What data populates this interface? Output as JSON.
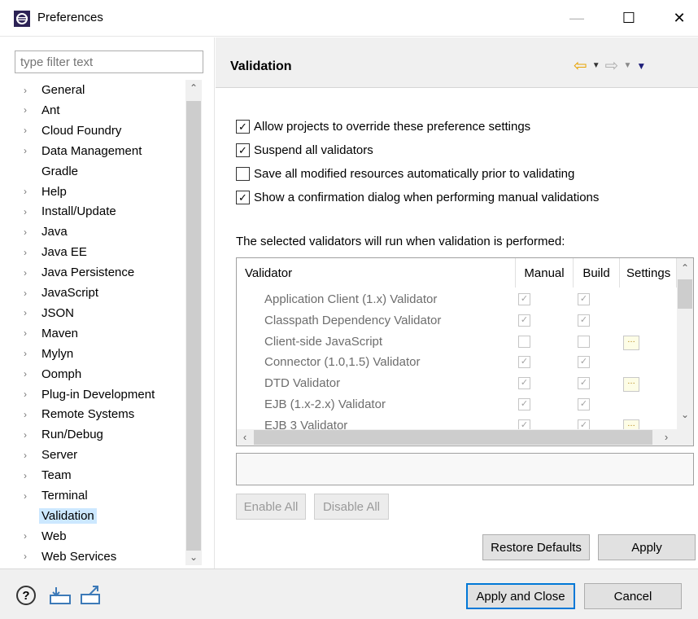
{
  "window": {
    "title": "Preferences",
    "minimize": "—",
    "maximize": "☐",
    "close": "✕"
  },
  "filter": {
    "placeholder": "type filter text"
  },
  "tree": {
    "items": [
      {
        "label": "General",
        "expandable": true
      },
      {
        "label": "Ant",
        "expandable": true
      },
      {
        "label": "Cloud Foundry",
        "expandable": true
      },
      {
        "label": "Data Management",
        "expandable": true
      },
      {
        "label": "Gradle",
        "expandable": false
      },
      {
        "label": "Help",
        "expandable": true
      },
      {
        "label": "Install/Update",
        "expandable": true
      },
      {
        "label": "Java",
        "expandable": true
      },
      {
        "label": "Java EE",
        "expandable": true
      },
      {
        "label": "Java Persistence",
        "expandable": true
      },
      {
        "label": "JavaScript",
        "expandable": true
      },
      {
        "label": "JSON",
        "expandable": true
      },
      {
        "label": "Maven",
        "expandable": true
      },
      {
        "label": "Mylyn",
        "expandable": true
      },
      {
        "label": "Oomph",
        "expandable": true
      },
      {
        "label": "Plug-in Development",
        "expandable": true
      },
      {
        "label": "Remote Systems",
        "expandable": true
      },
      {
        "label": "Run/Debug",
        "expandable": true
      },
      {
        "label": "Server",
        "expandable": true
      },
      {
        "label": "Team",
        "expandable": true
      },
      {
        "label": "Terminal",
        "expandable": true
      },
      {
        "label": "Validation",
        "expandable": false,
        "selected": true
      },
      {
        "label": "Web",
        "expandable": true
      },
      {
        "label": "Web Services",
        "expandable": true
      }
    ]
  },
  "page": {
    "title": "Validation",
    "options": [
      {
        "label": "Allow projects to override these preference settings",
        "checked": true
      },
      {
        "label": "Suspend all validators",
        "checked": true
      },
      {
        "label": "Save all modified resources automatically prior to validating",
        "checked": false
      },
      {
        "label": "Show a confirmation dialog when performing manual validations",
        "checked": true
      }
    ],
    "validators_label": "The selected validators will run when validation is performed:",
    "table": {
      "headers": {
        "validator": "Validator",
        "manual": "Manual",
        "build": "Build",
        "settings": "Settings"
      },
      "rows": [
        {
          "name": "Application Client (1.x) Validator",
          "manual": true,
          "build": true,
          "settings": false
        },
        {
          "name": "Classpath Dependency Validator",
          "manual": true,
          "build": true,
          "settings": false
        },
        {
          "name": "Client-side JavaScript",
          "manual": false,
          "build": false,
          "settings": true
        },
        {
          "name": "Connector (1.0,1.5) Validator",
          "manual": true,
          "build": true,
          "settings": false
        },
        {
          "name": "DTD Validator",
          "manual": true,
          "build": true,
          "settings": true
        },
        {
          "name": "EJB (1.x-2.x) Validator",
          "manual": true,
          "build": true,
          "settings": false
        },
        {
          "name": "EJB 3 Validator",
          "manual": true,
          "build": true,
          "settings": true
        }
      ]
    },
    "enable_all": "Enable All",
    "disable_all": "Disable All",
    "restore_defaults": "Restore Defaults",
    "apply": "Apply"
  },
  "footer": {
    "apply_close": "Apply and Close",
    "cancel": "Cancel",
    "help": "?"
  },
  "colors": {
    "selection": "#cce8ff",
    "default_button_border": "#0078d7",
    "nav_back": "#e7a200"
  }
}
